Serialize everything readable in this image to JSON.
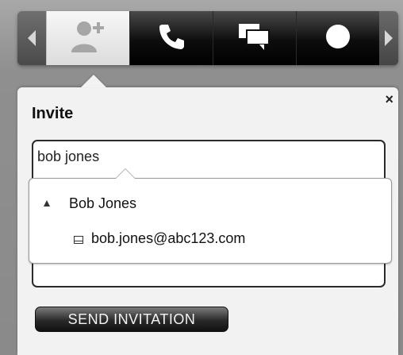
{
  "toolbar": {
    "buttons": [
      {
        "icon": "add-user-icon",
        "active": true
      },
      {
        "icon": "phone-icon",
        "active": false
      },
      {
        "icon": "chat-icon",
        "active": false
      },
      {
        "icon": "record-icon",
        "active": false
      }
    ]
  },
  "invite_panel": {
    "title": "Invite",
    "close_label": "×",
    "input_value": "bob jones",
    "suggestion": {
      "name": "Bob Jones",
      "email": "bob.jones@abc123.com"
    },
    "send_button_label": "SEND INVITATION"
  },
  "colors": {
    "toolbar_dark": "#111111",
    "active_tab": "#f2f2f2",
    "panel_bg": "#f2f2f2",
    "text": "#111111"
  }
}
